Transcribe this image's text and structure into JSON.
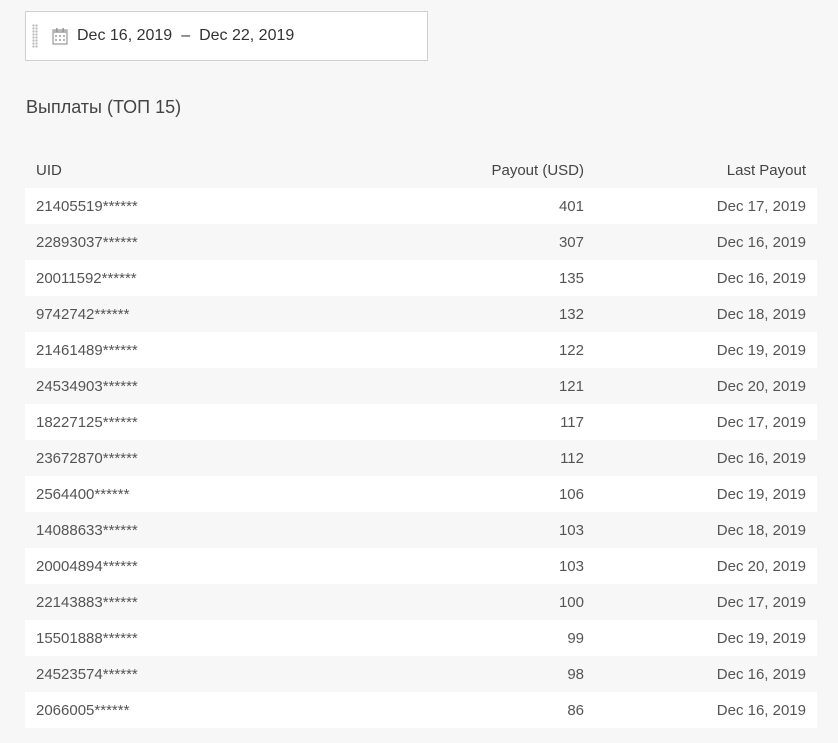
{
  "date_range": {
    "start": "Dec 16, 2019",
    "separator": "–",
    "end": "Dec 22, 2019"
  },
  "section_title": "Выплаты (ТОП 15)",
  "table": {
    "headers": {
      "uid": "UID",
      "payout": "Payout (USD)",
      "last_payout": "Last Payout"
    },
    "rows": [
      {
        "uid": "21405519******",
        "payout": "401",
        "last_payout": "Dec 17, 2019"
      },
      {
        "uid": "22893037******",
        "payout": "307",
        "last_payout": "Dec 16, 2019"
      },
      {
        "uid": "20011592******",
        "payout": "135",
        "last_payout": "Dec 16, 2019"
      },
      {
        "uid": "9742742******",
        "payout": "132",
        "last_payout": "Dec 18, 2019"
      },
      {
        "uid": "21461489******",
        "payout": "122",
        "last_payout": "Dec 19, 2019"
      },
      {
        "uid": "24534903******",
        "payout": "121",
        "last_payout": "Dec 20, 2019"
      },
      {
        "uid": "18227125******",
        "payout": "117",
        "last_payout": "Dec 17, 2019"
      },
      {
        "uid": "23672870******",
        "payout": "112",
        "last_payout": "Dec 16, 2019"
      },
      {
        "uid": "2564400******",
        "payout": "106",
        "last_payout": "Dec 19, 2019"
      },
      {
        "uid": "14088633******",
        "payout": "103",
        "last_payout": "Dec 18, 2019"
      },
      {
        "uid": "20004894******",
        "payout": "103",
        "last_payout": "Dec 20, 2019"
      },
      {
        "uid": "22143883******",
        "payout": "100",
        "last_payout": "Dec 17, 2019"
      },
      {
        "uid": "15501888******",
        "payout": "99",
        "last_payout": "Dec 19, 2019"
      },
      {
        "uid": "24523574******",
        "payout": "98",
        "last_payout": "Dec 16, 2019"
      },
      {
        "uid": "2066005******",
        "payout": "86",
        "last_payout": "Dec 16, 2019"
      }
    ]
  },
  "icons": {
    "drag": "drag-handle-icon",
    "calendar": "calendar-icon"
  }
}
